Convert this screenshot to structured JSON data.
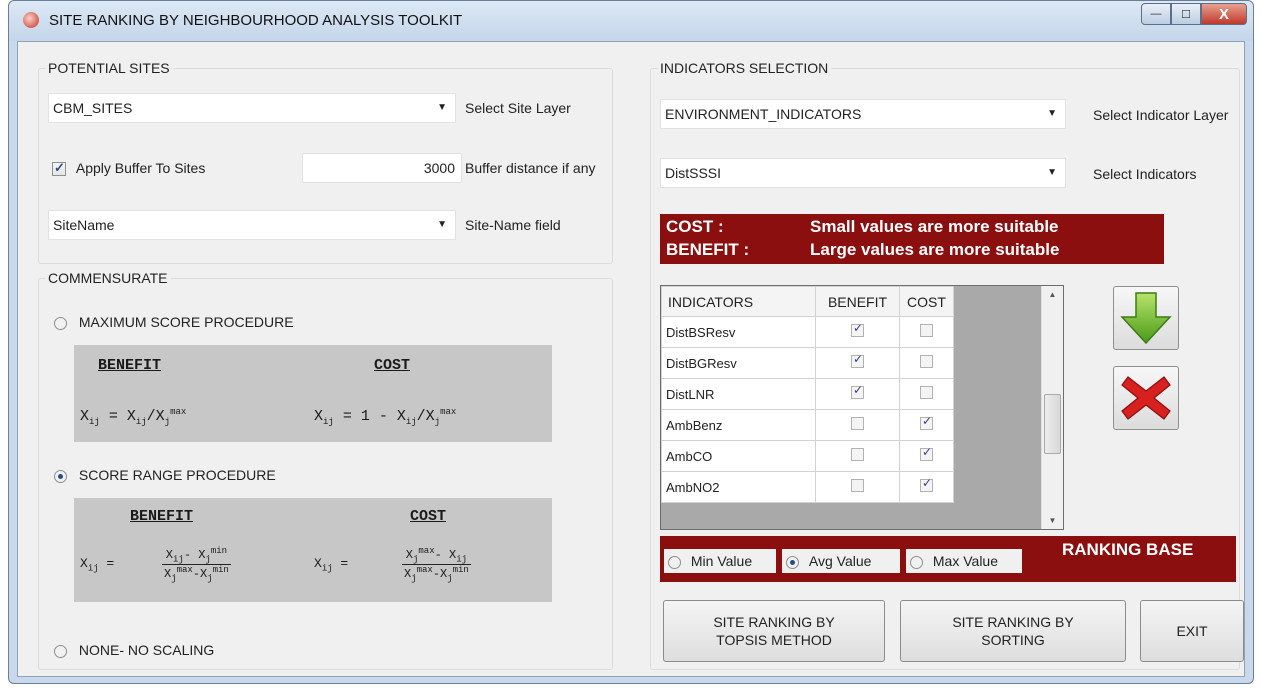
{
  "window": {
    "title": "SITE RANKING BY NEIGHBOURHOOD ANALYSIS TOOLKIT",
    "controls": {
      "minimize": "—",
      "maximize": "☐",
      "close": "X"
    }
  },
  "potential_sites": {
    "legend": "POTENTIAL SITES",
    "site_layer_value": "CBM_SITES",
    "site_layer_label": "Select Site Layer",
    "apply_buffer_label": "Apply Buffer To Sites",
    "apply_buffer_checked": true,
    "buffer_distance_value": "3000",
    "buffer_distance_label": "Buffer distance if any",
    "site_name_value": "SiteName",
    "site_name_label": "Site-Name field"
  },
  "commensurate": {
    "legend": "COMMENSURATE",
    "options": {
      "max_score": "MAXIMUM SCORE  PROCEDURE",
      "score_range": "SCORE RANGE PROCEDURE",
      "none": "NONE- NO SCALING"
    },
    "selected": "score_range",
    "benefit_heading": "BENEFIT",
    "cost_heading": "COST"
  },
  "indicators_selection": {
    "legend": "INDICATORS SELECTION",
    "indicator_layer_value": "ENVIRONMENT_INDICATORS",
    "indicator_layer_label": "Select Indicator Layer",
    "indicator_value": "DistSSSI",
    "indicator_label": "Select Indicators",
    "note_cost_key": "COST        :",
    "note_cost_text": "Small values are more suitable",
    "note_benefit_key": "BENEFIT :",
    "note_benefit_text": "Large values are more suitable",
    "grid_headers": [
      "INDICATORS",
      "BENEFIT",
      "COST"
    ],
    "grid_rows": [
      {
        "name": "DistBSResv",
        "benefit": true,
        "cost": false
      },
      {
        "name": "DistBGResv",
        "benefit": true,
        "cost": false
      },
      {
        "name": "DistLNR",
        "benefit": true,
        "cost": false
      },
      {
        "name": "AmbBenz",
        "benefit": false,
        "cost": true
      },
      {
        "name": "AmbCO",
        "benefit": false,
        "cost": true
      },
      {
        "name": "AmbNO2",
        "benefit": false,
        "cost": true
      }
    ]
  },
  "ranking_base": {
    "label": "RANKING BASE",
    "min_label": "Min Value",
    "avg_label": "Avg Value",
    "max_label": "Max Value",
    "selected": "avg"
  },
  "buttons": {
    "topsis_line1": "SITE RANKING BY",
    "topsis_line2": "TOPSIS METHOD",
    "sorting_line1": "SITE RANKING BY",
    "sorting_line2": "SORTING",
    "exit": "EXIT",
    "add_icon": "down-arrow-icon",
    "remove_icon": "red-x-icon"
  },
  "colors": {
    "accent_red": "#8b0f0f",
    "arrow_green": "#6cbf2a",
    "remove_red": "#d8201e"
  }
}
